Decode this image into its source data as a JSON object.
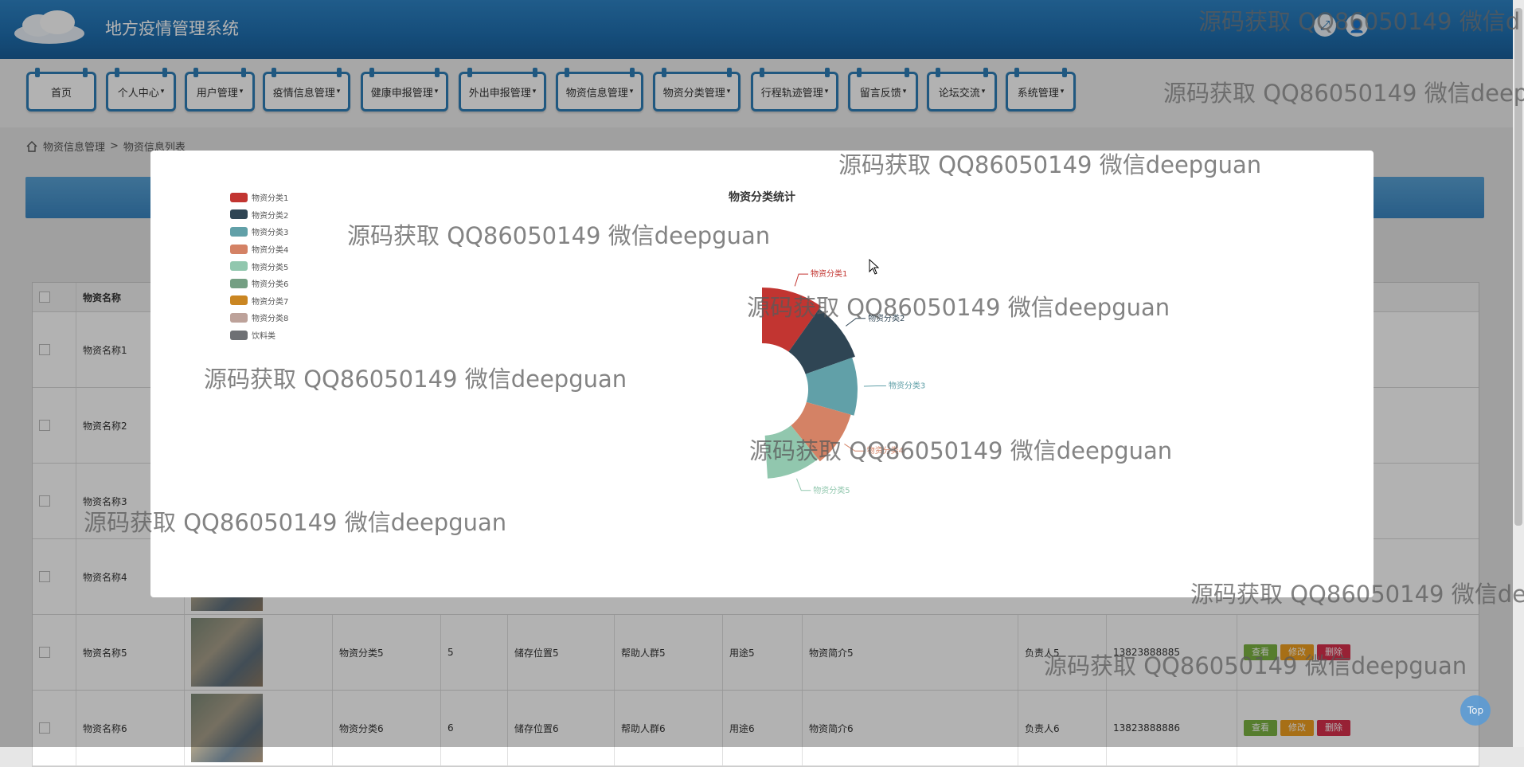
{
  "header": {
    "title": "地方疫情管理系统"
  },
  "nav": {
    "items": [
      {
        "label": "首页",
        "dropdown": false
      },
      {
        "label": "个人中心",
        "dropdown": true
      },
      {
        "label": "用户管理",
        "dropdown": true
      },
      {
        "label": "疫情信息管理",
        "dropdown": true
      },
      {
        "label": "健康申报管理",
        "dropdown": true
      },
      {
        "label": "外出申报管理",
        "dropdown": true
      },
      {
        "label": "物资信息管理",
        "dropdown": true
      },
      {
        "label": "物资分类管理",
        "dropdown": true
      },
      {
        "label": "行程轨迹管理",
        "dropdown": true
      },
      {
        "label": "留言反馈",
        "dropdown": true
      },
      {
        "label": "论坛交流",
        "dropdown": true
      },
      {
        "label": "系统管理",
        "dropdown": true
      }
    ]
  },
  "breadcrumb": {
    "parent": "物资信息管理",
    "sep": ">",
    "current": "物资信息列表"
  },
  "table": {
    "header_name": "物资名称",
    "rows": [
      {
        "name": "物资名称1"
      },
      {
        "name": "物资名称2"
      },
      {
        "name": "物资名称3"
      },
      {
        "name": "物资名称4"
      },
      {
        "name": "物资名称5",
        "category": "物资分类5",
        "qty": "5",
        "location": "储存位置5",
        "group": "帮助人群5",
        "usage": "用途5",
        "intro": "物资简介5",
        "owner": "负责人5",
        "phone": "13823888885"
      },
      {
        "name": "物资名称6",
        "category": "物资分类6",
        "qty": "6",
        "location": "储存位置6",
        "group": "帮助人群6",
        "usage": "用途6",
        "intro": "物资简介6",
        "owner": "负责人6",
        "phone": "13823888886"
      }
    ],
    "actions": {
      "view": "查看",
      "edit": "修改",
      "delete": "删除"
    }
  },
  "chart_data": {
    "type": "pie",
    "title": "物资分类统计",
    "legend_position": "top-left",
    "categories": [
      "物资分类1",
      "物资分类2",
      "物资分类3",
      "物资分类4",
      "物资分类5",
      "物资分类6",
      "物资分类7",
      "物资分类8",
      "饮料类"
    ],
    "colors": [
      "#c23531",
      "#2f4554",
      "#61a0a8",
      "#d48265",
      "#91c7ae",
      "#749f83",
      "#ca8622",
      "#bda29a",
      "#6e7074"
    ],
    "values": [
      1,
      1,
      1,
      1,
      1,
      0,
      0,
      0,
      0
    ],
    "label_series": [
      "物资分类1",
      "物资分类2",
      "物资分类3",
      "物资分类4",
      "物资分类5"
    ]
  },
  "watermark": {
    "text": "源码获取 QQ86050149 微信deepguan",
    "cut_texts": [
      "源码获取 QQ86050149 微信d",
      "源码获取 QQ86050149 微信deep",
      "源码获取 QQ86050149 微信de"
    ]
  },
  "top_button": {
    "label": "Top"
  }
}
